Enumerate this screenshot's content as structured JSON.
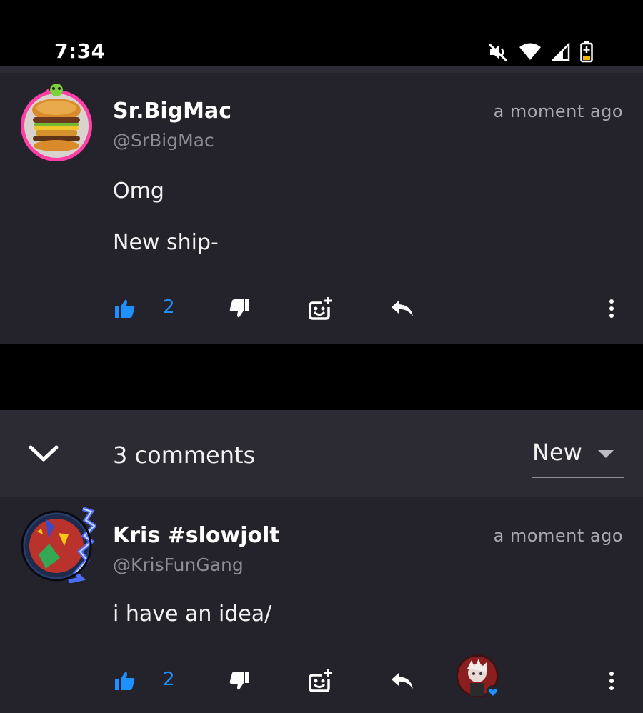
{
  "status_bar": {
    "time": "7:34",
    "icons": [
      "mute-icon",
      "wifi-icon",
      "signal-icon",
      "battery-charging-icon"
    ]
  },
  "comments": [
    {
      "author": "Sr.BigMac",
      "handle": "@SrBigMac",
      "timestamp": "a moment ago",
      "body": [
        "Omg",
        "New ship-"
      ],
      "likes": "2"
    },
    {
      "author": "Kris #slowjolt",
      "handle": "@KrisFunGang",
      "timestamp": "a moment ago",
      "body": [
        "i have an idea/"
      ],
      "likes": "2"
    }
  ],
  "comments_header": {
    "count_label": "3 comments",
    "sort_value": "New"
  },
  "colors": {
    "accent": "#1e90ff",
    "card_bg": "#24222a",
    "header_bg": "#2c2a33",
    "muted_text": "#8d8b95"
  }
}
